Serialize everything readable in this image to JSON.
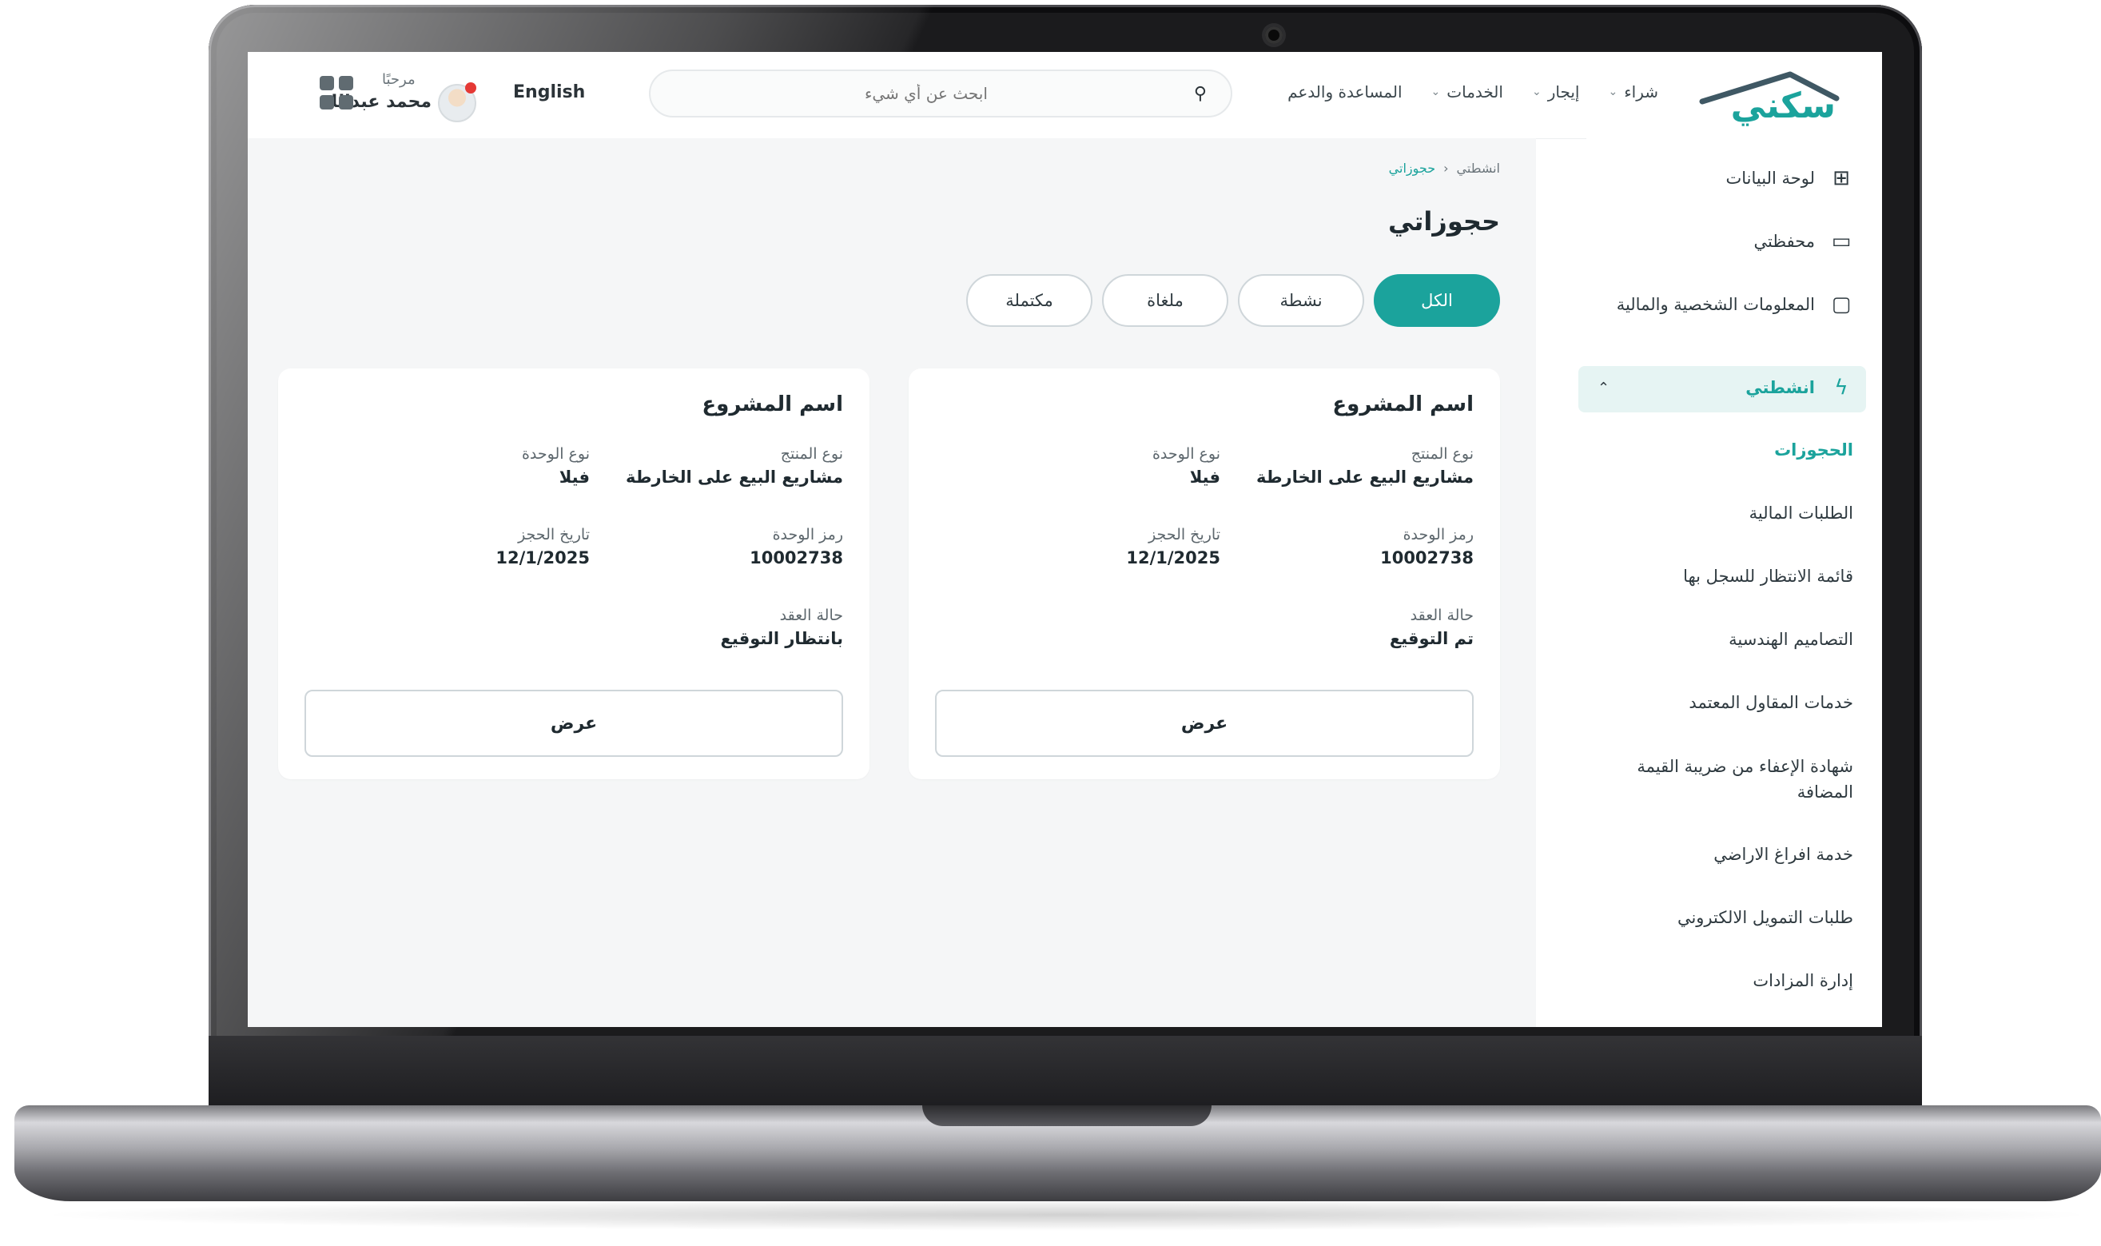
{
  "header": {
    "logo_text": "سكني",
    "nav": [
      {
        "label": "شراء",
        "has_dropdown": true
      },
      {
        "label": "إيجار",
        "has_dropdown": true
      },
      {
        "label": "الخدمات",
        "has_dropdown": true
      },
      {
        "label": "المساعدة والدعم",
        "has_dropdown": false
      }
    ],
    "search_placeholder": "ابحث عن أي شيء",
    "language_toggle": "English",
    "greeting": "مرحبًا",
    "user_name": "محمد عبدالله",
    "accent_color": "#1ba39c"
  },
  "sidebar": {
    "items": [
      {
        "label": "لوحة البيانات",
        "icon": "grid-icon"
      },
      {
        "label": "محفظتي",
        "icon": "wallet-icon"
      },
      {
        "label": "المعلومات الشخصية والمالية",
        "icon": "monitor-icon"
      },
      {
        "label": "انشطتي",
        "icon": "lightning-icon",
        "expanded": true
      }
    ],
    "subitems": [
      {
        "label": "الحجوزات",
        "current": true
      },
      {
        "label": "الطلبات المالية"
      },
      {
        "label": "قائمة الانتظار للسجل بها"
      },
      {
        "label": "التصاميم الهندسية"
      },
      {
        "label": "خدمات المقاول المعتمد"
      },
      {
        "label": "شهادة الإعفاء من ضريبة القيمة المضافة"
      },
      {
        "label": "خدمة افراغ الاراضي"
      },
      {
        "label": "طلبات التمويل الالكتروني"
      },
      {
        "label": "إدارة المزادات"
      }
    ]
  },
  "main": {
    "breadcrumb": [
      "انشطتي",
      "حجوزاتي"
    ],
    "page_title": "حجوزاتي",
    "filters": [
      {
        "label": "الكل",
        "active": true
      },
      {
        "label": "نشطة",
        "active": false
      },
      {
        "label": "ملغاة",
        "active": false
      },
      {
        "label": "مكتملة",
        "active": false
      }
    ],
    "labels": {
      "product_type": "نوع المنتج",
      "unit_type": "نوع الوحدة",
      "unit_code": "رمز الوحدة",
      "booking_date": "تاريخ الحجز",
      "contract_status": "حالة العقد"
    },
    "cards": [
      {
        "project_name": "اسم المشروع",
        "product_type": "مشاريع البيع على الخارطة",
        "unit_type": "فيلا",
        "unit_code": "10002738",
        "booking_date": "12/1/2025",
        "contract_status": "تم التوقيع",
        "button": "عرض"
      },
      {
        "project_name": "اسم المشروع",
        "product_type": "مشاريع البيع على الخارطة",
        "unit_type": "فيلا",
        "unit_code": "10002738",
        "booking_date": "12/1/2025",
        "contract_status": "بانتظار التوقيع",
        "button": "عرض"
      }
    ]
  }
}
